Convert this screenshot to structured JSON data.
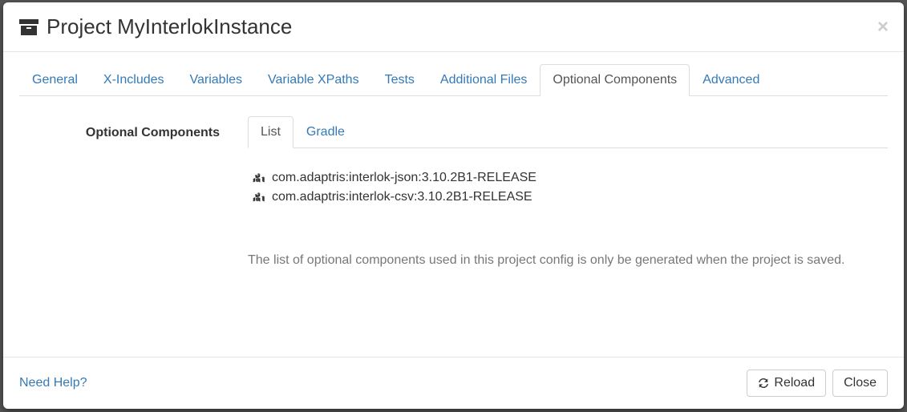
{
  "header": {
    "title": "Project MyInterlokInstance"
  },
  "tabs": {
    "items": [
      {
        "label": "General"
      },
      {
        "label": "X-Includes"
      },
      {
        "label": "Variables"
      },
      {
        "label": "Variable XPaths"
      },
      {
        "label": "Tests"
      },
      {
        "label": "Additional Files"
      },
      {
        "label": "Optional Components"
      },
      {
        "label": "Advanced"
      }
    ],
    "active_index": 6
  },
  "section": {
    "heading": "Optional Components",
    "sub_tabs": {
      "items": [
        {
          "label": "List"
        },
        {
          "label": "Gradle"
        }
      ],
      "active_index": 0
    },
    "components": [
      "com.adaptris:interlok-json:3.10.2B1-RELEASE",
      "com.adaptris:interlok-csv:3.10.2B1-RELEASE"
    ],
    "note": "The list of optional components used in this project config is only be generated when the project is saved."
  },
  "footer": {
    "help_label": "Need Help?",
    "reload_label": "Reload",
    "close_label": "Close"
  }
}
